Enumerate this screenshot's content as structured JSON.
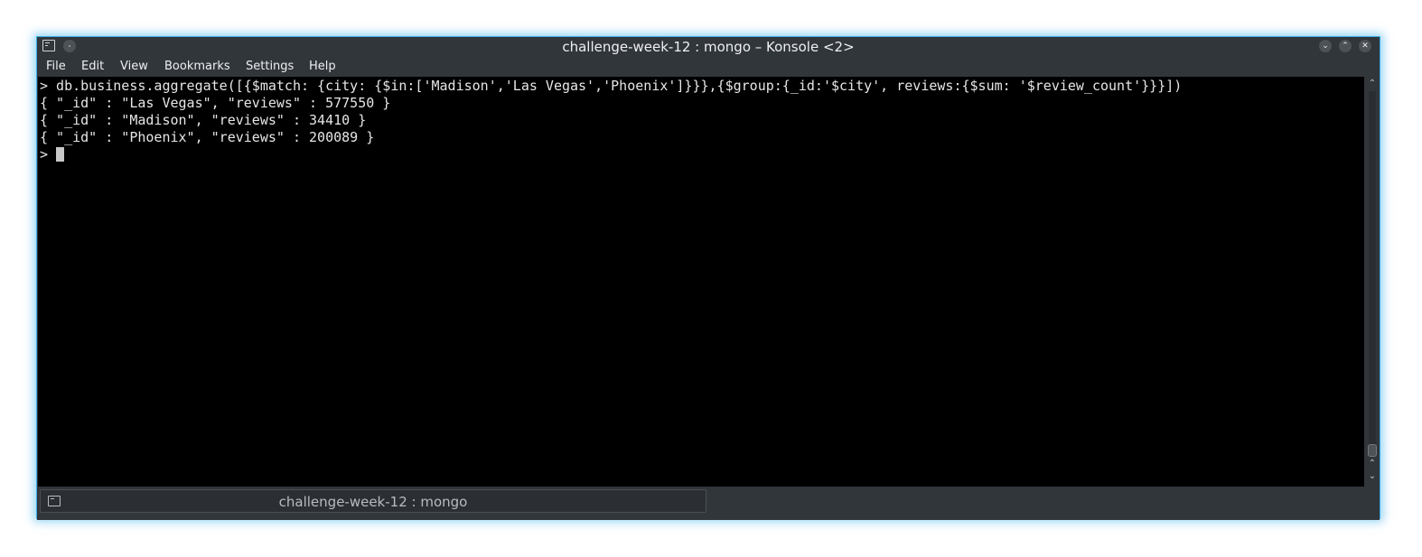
{
  "window": {
    "title": "challenge-week-12 : mongo – Konsole <2>"
  },
  "titlebar_buttons": {
    "minimize": "⌄",
    "maximize": "⌃",
    "close": "✕"
  },
  "menu": {
    "items": [
      "File",
      "Edit",
      "View",
      "Bookmarks",
      "Settings",
      "Help"
    ]
  },
  "terminal": {
    "lines": [
      "> db.business.aggregate([{$match: {city: {$in:['Madison','Las Vegas','Phoenix']}}},{$group:{_id:'$city', reviews:{$sum: '$review_count'}}}])",
      "{ \"_id\" : \"Las Vegas\", \"reviews\" : 577550 }",
      "{ \"_id\" : \"Madison\", \"reviews\" : 34410 }",
      "{ \"_id\" : \"Phoenix\", \"reviews\" : 200089 }",
      "> "
    ]
  },
  "scrollbar": {
    "up_arrow": "⌃",
    "down_arrows": "⌃",
    "down_arrow": "⌄"
  },
  "tabs": [
    {
      "label": "challenge-week-12 : mongo",
      "icon": "terminal-icon"
    }
  ],
  "colors": {
    "accent": "#3daee9",
    "chrome": "#31363b",
    "terminal_bg": "#000000",
    "terminal_fg": "#e6e6e6"
  }
}
